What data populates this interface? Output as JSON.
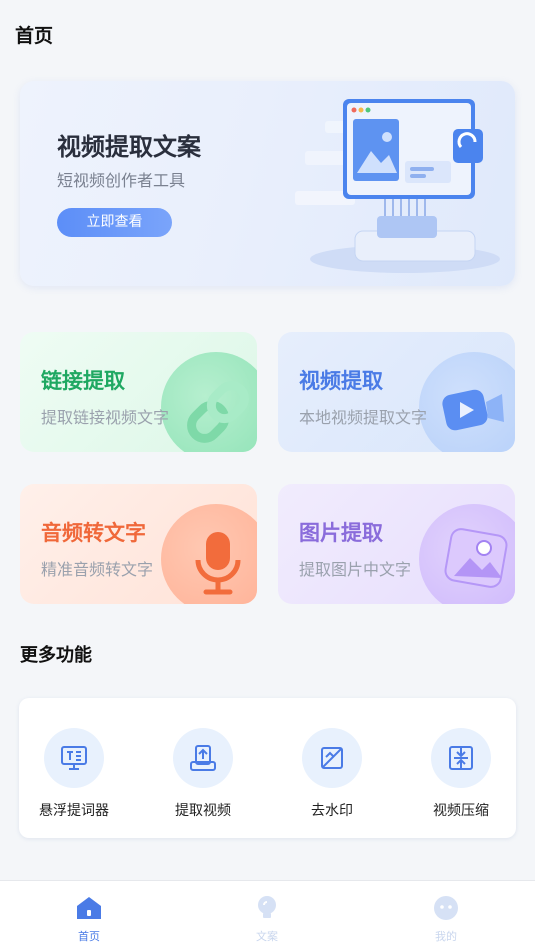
{
  "header": {
    "title": "首页"
  },
  "banner": {
    "title": "视频提取文案",
    "subtitle": "短视频创作者工具",
    "button_label": "立即查看"
  },
  "cards": {
    "link": {
      "title": "链接提取",
      "subtitle": "提取链接视频文字"
    },
    "video": {
      "title": "视频提取",
      "subtitle": "本地视频提取文字"
    },
    "audio": {
      "title": "音频转文字",
      "subtitle": "精准音频转文字"
    },
    "image": {
      "title": "图片提取",
      "subtitle": "提取图片中文字"
    }
  },
  "more": {
    "title": "更多功能",
    "tools": [
      {
        "label": "悬浮提词器",
        "icon": "teleprompter-icon"
      },
      {
        "label": "提取视频",
        "icon": "extract-video-icon"
      },
      {
        "label": "去水印",
        "icon": "remove-watermark-icon"
      },
      {
        "label": "视频压缩",
        "icon": "video-compress-icon"
      }
    ]
  },
  "nav": {
    "items": [
      {
        "label": "首页",
        "icon": "home-icon",
        "active": true
      },
      {
        "label": "文案",
        "icon": "bulb-icon",
        "active": false
      },
      {
        "label": "我的",
        "icon": "profile-icon",
        "active": false
      }
    ]
  },
  "colors": {
    "accent": "#4a7be6",
    "link": "#1fa862",
    "audio": "#f0683a",
    "image": "#8a6cdb"
  }
}
